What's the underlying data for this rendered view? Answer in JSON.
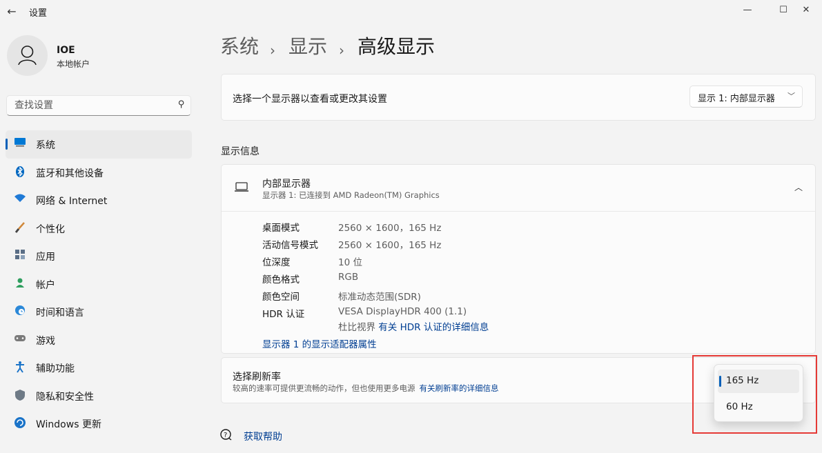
{
  "window": {
    "title": "设置"
  },
  "user": {
    "name": "IOE",
    "account_type": "本地帐户"
  },
  "search": {
    "placeholder": "查找设置"
  },
  "sidebar": {
    "items": [
      {
        "label": "系统",
        "icon": "system-icon",
        "active": true
      },
      {
        "label": "蓝牙和其他设备",
        "icon": "bluetooth-icon"
      },
      {
        "label": "网络 & Internet",
        "icon": "wifi-icon"
      },
      {
        "label": "个性化",
        "icon": "brush-icon"
      },
      {
        "label": "应用",
        "icon": "apps-icon"
      },
      {
        "label": "帐户",
        "icon": "account-icon"
      },
      {
        "label": "时间和语言",
        "icon": "globe-clock-icon"
      },
      {
        "label": "游戏",
        "icon": "gamepad-icon"
      },
      {
        "label": "辅助功能",
        "icon": "accessibility-icon"
      },
      {
        "label": "隐私和安全性",
        "icon": "shield-icon"
      },
      {
        "label": "Windows 更新",
        "icon": "update-icon"
      }
    ]
  },
  "breadcrumb": {
    "level1": "系统",
    "level2": "显示",
    "current": "高级显示"
  },
  "select_display": {
    "label": "选择一个显示器以查看或更改其设置",
    "selected": "显示 1: 内部显示器"
  },
  "display_info": {
    "section_title": "显示信息",
    "name": "内部显示器",
    "subtitle": "显示器 1: 已连接到 AMD Radeon(TM) Graphics",
    "rows": [
      {
        "label": "桌面模式",
        "value": "2560 × 1600，165 Hz"
      },
      {
        "label": "活动信号模式",
        "value": "2560 × 1600，165 Hz"
      },
      {
        "label": "位深度",
        "value": "10 位"
      },
      {
        "label": "颜色格式",
        "value": "RGB"
      },
      {
        "label": "颜色空间",
        "value": "标准动态范围(SDR)"
      },
      {
        "label": "HDR 认证",
        "value": "VESA DisplayHDR 400 (1.1)"
      }
    ],
    "hdr_extra_prefix": "杜比视界",
    "hdr_link": "有关 HDR 认证的详细信息",
    "adapter_link": "显示器 1 的显示适配器属性"
  },
  "refresh_rate": {
    "title": "选择刷新率",
    "description": "较高的速率可提供更流畅的动作，但也使用更多电源",
    "link": "有关刷新率的详细信息",
    "options": [
      "165 Hz",
      "60 Hz"
    ],
    "selected": "165 Hz"
  },
  "help": {
    "label": "获取帮助"
  },
  "colors": {
    "accent": "#005fb8",
    "link": "#003e92",
    "highlight_box": "#e53935"
  }
}
